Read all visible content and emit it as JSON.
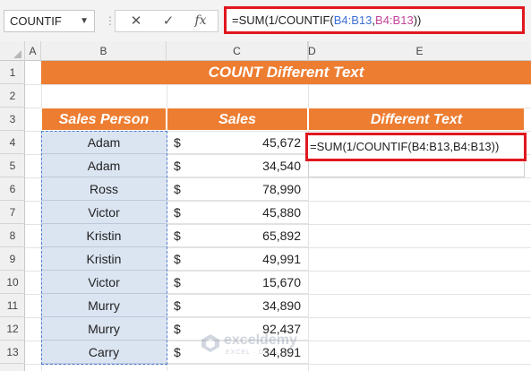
{
  "formula_bar": {
    "name_box": "COUNTIF",
    "cancel_icon": "✕",
    "enter_icon": "✓",
    "fx_label": "fx",
    "formula_prefix": "=SUM(1/COUNTIF(",
    "formula_ref1": "B4:B13",
    "formula_comma": ",",
    "formula_ref2": "B4:B13",
    "formula_suffix": "))"
  },
  "columns": [
    "A",
    "B",
    "C",
    "D",
    "E"
  ],
  "rows": [
    "1",
    "2",
    "3",
    "4",
    "5",
    "6",
    "7",
    "8",
    "9",
    "10",
    "11",
    "12",
    "13"
  ],
  "sheet": {
    "title": "COUNT Different Text",
    "header_sales_person": "Sales Person",
    "header_sales": "Sales",
    "header_different_text": "Different Text",
    "currency_symbol": "$",
    "records": [
      {
        "name": "Adam",
        "sales": "45,672"
      },
      {
        "name": "Adam",
        "sales": "34,540"
      },
      {
        "name": "Ross",
        "sales": "78,990"
      },
      {
        "name": "Victor",
        "sales": "45,880"
      },
      {
        "name": "Kristin",
        "sales": "65,892"
      },
      {
        "name": "Kristin",
        "sales": "49,991"
      },
      {
        "name": "Victor",
        "sales": "15,670"
      },
      {
        "name": "Murry",
        "sales": "34,890"
      },
      {
        "name": "Murry",
        "sales": "92,437"
      },
      {
        "name": "Carry",
        "sales": "34,891"
      }
    ],
    "cell_e4_formula": "=SUM(1/COUNTIF(B4:B13,B4:B13))"
  },
  "watermark": {
    "brand": "exceldemy",
    "tagline": "EXCEL · DATA · BI"
  },
  "colors": {
    "accent_orange": "#ed7d31",
    "highlight_red": "#e0171f",
    "selection_fill": "#dbe5f2"
  }
}
